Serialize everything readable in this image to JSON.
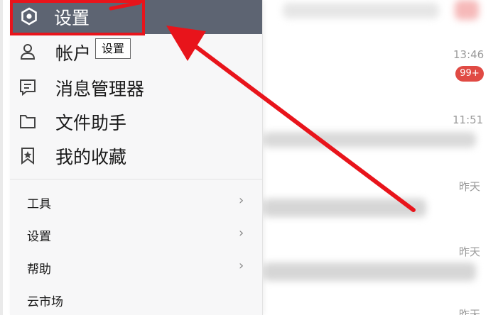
{
  "menu": {
    "header": {
      "label": "设置"
    },
    "items": [
      {
        "label": "帐户",
        "icon": "user-icon"
      },
      {
        "label": "消息管理器",
        "icon": "message-manager-icon"
      },
      {
        "label": "文件助手",
        "icon": "folder-icon"
      },
      {
        "label": "我的收藏",
        "icon": "bookmark-icon"
      }
    ],
    "tooltip": "设置",
    "submenu": [
      {
        "label": "工具",
        "chevron": "›"
      },
      {
        "label": "设置",
        "chevron": "›"
      },
      {
        "label": "帮助",
        "chevron": "›"
      },
      {
        "label": "云市场"
      }
    ]
  },
  "chats": {
    "times": [
      "13:46",
      "11:51",
      "昨天",
      "昨天",
      "昨天"
    ],
    "unread_badge": "99+"
  },
  "colors": {
    "menu_header": "#5d6472",
    "menu_bg": "#f7f7f8",
    "annotation_red": "#e8141b",
    "badge_red": "#e04a44"
  }
}
